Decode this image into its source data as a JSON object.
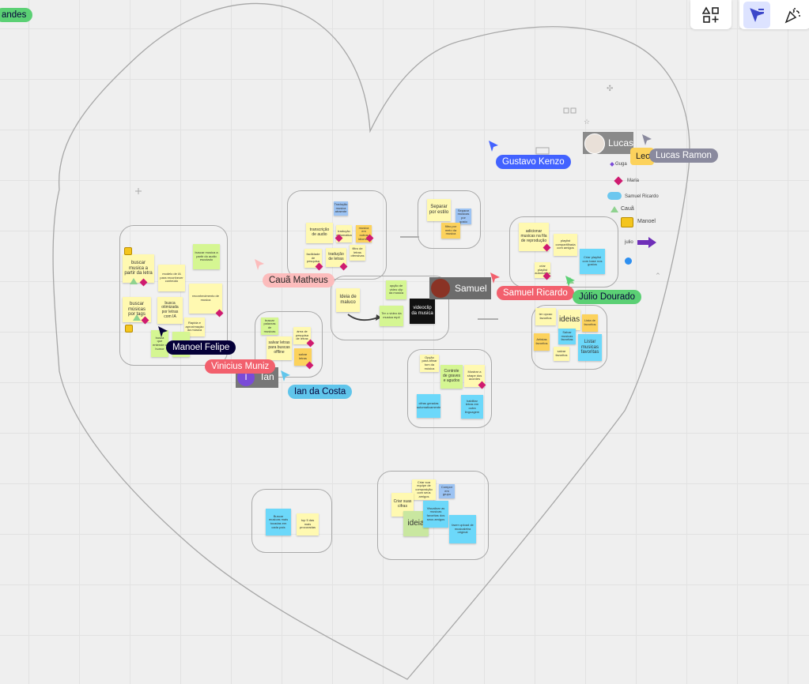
{
  "top_left_pill": {
    "label": "andes"
  },
  "toolbar": {
    "shapes_icon": "shapes-plus-icon",
    "cursor_icon": "cursor-filter-icon",
    "reactions_icon": "party-popper-icon"
  },
  "collaborators": [
    {
      "name": "Gustavo Kenzo",
      "color": "#4262ff"
    },
    {
      "name": "Lucas Ramon",
      "color": "#8a8a9e"
    },
    {
      "name": "Cauã Matheus",
      "color": "#fcbcbc"
    },
    {
      "name": "Samuel Ricardo",
      "color": "#f2606d"
    },
    {
      "name": "Júlio Dourado",
      "color": "#5bd074"
    },
    {
      "name": "Manoel Felipe",
      "color": "#050038"
    },
    {
      "name": "Vinicius Muniz",
      "color": "#f2606d"
    },
    {
      "name": "Ian da Costa",
      "color": "#60c5eb"
    }
  ],
  "user_tags": {
    "lucas": "Lucas",
    "leo": "Leo",
    "ian": "Ian",
    "ian_initial": "I",
    "samuel": "Samuel"
  },
  "legend": [
    "Guga",
    "Maria",
    "Samuel Ricardo",
    "Cauã",
    "Manoel",
    "julio"
  ],
  "notes": {
    "buscar_letra": "buscar musica a partir da letra",
    "modelo_ia": "modelo de IA para reconhecer conteúdo",
    "buscar_audio": "buscar musica a partir do audio escutado",
    "reconhecimento": "reconhecimento de musica",
    "buscar_tags": "buscar músicas por tags",
    "busca_otimizada": "busca otimizada por letras com IA",
    "rapida": "Rapida e aproximaçâo da música",
    "small1": "busca que entende o humor",
    "small2": "pesquisa",
    "transcricao": "transcrição de audio",
    "traducao_musica": "Tradução musica atraente",
    "traducao_letras": "tradução de letras",
    "traducao_auto": "traduçâo automatica",
    "facilidade": "facilidade de pesquisa",
    "idiomas": "musica em outros idiomas",
    "filtro_letras": "filtro de letras ofensivas",
    "separar_estilo": "Separar por estilo",
    "separar_gosto": "Separar musicas por gosto",
    "filtro_meio": "filtro por meio da musica",
    "adicionar_fila": "adicionar musicas na fila de reprodução",
    "playlist_compart": "playlist compartilhada com amigos",
    "playlist_ia": "Criar playlist com base nos gostos",
    "playlist_auto": "criar playlist automatica",
    "salvar_letras": "salvar letras",
    "area_pesquisa": "área de pesquisa de letras",
    "salvar_letras_busca": "salvar letras para buscas offline",
    "busca_palavras": "buscar palavras de musicas",
    "opcao_video": "opção de video clip da musica",
    "ideia_maluco": "Ideia de maluco",
    "ter_video": "Ter o video da musica mp4",
    "videoclip": "videoclip da musica",
    "ideias_right": "ideias",
    "lista_fav": "Lista de favoritos",
    "salvar_musicas": "Salvar musicas favoritas",
    "artistas_fav": "Artistas favoritos",
    "listar_fav": "Listar musicas favoritas",
    "salvar_fav": "salvar favoritos",
    "ter_opcao": "ter opcao favoritos",
    "opcao_afinar": "Opção para afinar tom da música",
    "controle_graves": "Controle de graves e agudos",
    "mostrar_acordes": "Mostrar a shape dos acordes",
    "cifras_ia": "cifras geradas automaticamente",
    "habilitar_letras": "habilitar letras em outra linguagem",
    "buscar_tocadas": "Buscar musicas mais tocadas em cada país",
    "top5": "top 5 das mais procuradas",
    "criar_equipe": "Criar sua equipe de composição com seus amigos",
    "criar_cifras": "Criar suas cifras",
    "ideia_bottom": "ideia",
    "visualizar_favoritas": "Visualizar as musicas favoritas dos seus amigos",
    "fazer_upload": "fazer upload de musicaletra original",
    "blue_small": "Compor em grupo"
  }
}
